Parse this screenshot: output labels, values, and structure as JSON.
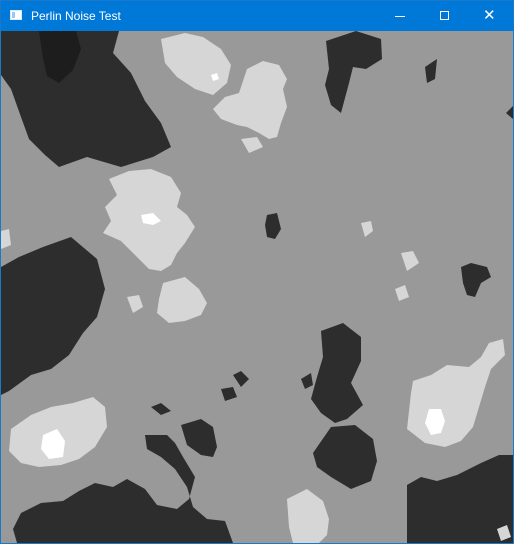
{
  "window": {
    "title": "Perlin Noise Test",
    "controls": {
      "minimize_icon": "minimize-icon",
      "maximize_icon": "maximize-icon",
      "close_icon": "close-icon"
    }
  },
  "noise_view": {
    "type": "perlin-noise-terrain",
    "levels": [
      {
        "name": "deep",
        "color": "#2d2d2d"
      },
      {
        "name": "base",
        "color": "#999999"
      },
      {
        "name": "light",
        "color": "#d6d6d6"
      },
      {
        "name": "peak",
        "color": "#ffffff"
      }
    ]
  }
}
